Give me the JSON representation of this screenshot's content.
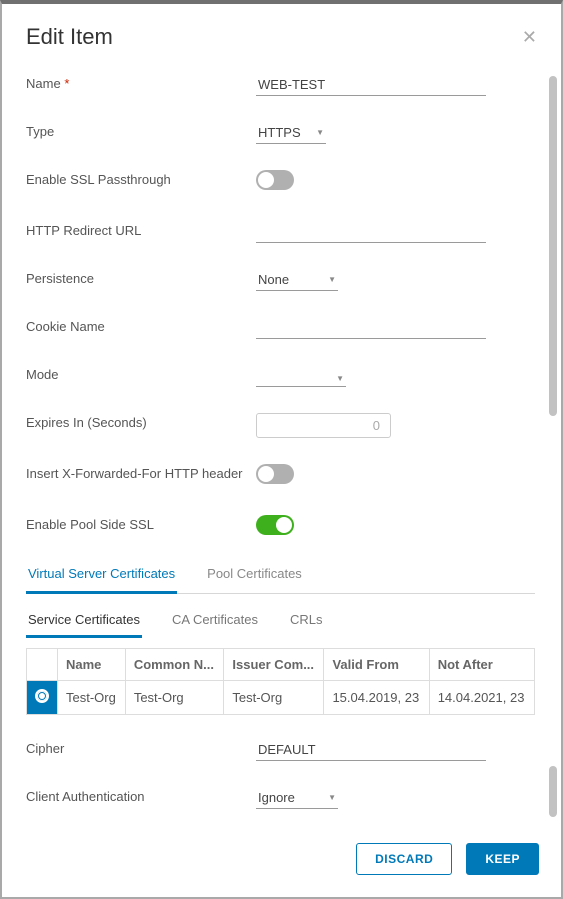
{
  "header": {
    "title": "Edit Item"
  },
  "form": {
    "name_label": "Name",
    "name_value": "WEB-TEST",
    "type_label": "Type",
    "type_value": "HTTPS",
    "ssl_passthrough_label": "Enable SSL Passthrough",
    "ssl_passthrough_on": false,
    "redirect_label": "HTTP Redirect URL",
    "redirect_value": "",
    "persistence_label": "Persistence",
    "persistence_value": "None",
    "cookie_label": "Cookie Name",
    "cookie_value": "",
    "mode_label": "Mode",
    "mode_value": "",
    "expires_label": "Expires In (Seconds)",
    "expires_value": "0",
    "xff_label": "Insert X-Forwarded-For HTTP header",
    "xff_on": false,
    "pool_ssl_label": "Enable Pool Side SSL",
    "pool_ssl_on": true,
    "cipher_label": "Cipher",
    "cipher_value": "DEFAULT",
    "client_auth_label": "Client Authentication",
    "client_auth_value": "Ignore"
  },
  "tabs": {
    "main": [
      "Virtual Server Certificates",
      "Pool Certificates"
    ],
    "sub": [
      "Service Certificates",
      "CA Certificates",
      "CRLs"
    ]
  },
  "cert_table": {
    "headers": [
      "Name",
      "Common N...",
      "Issuer Com...",
      "Valid From",
      "Not After"
    ],
    "rows": [
      {
        "name": "Test-Org",
        "cn": "Test-Org",
        "issuer": "Test-Org",
        "from": "15.04.2019, 23",
        "to": "14.04.2021, 23",
        "selected": true
      }
    ]
  },
  "footer": {
    "discard": "DISCARD",
    "keep": "KEEP"
  }
}
